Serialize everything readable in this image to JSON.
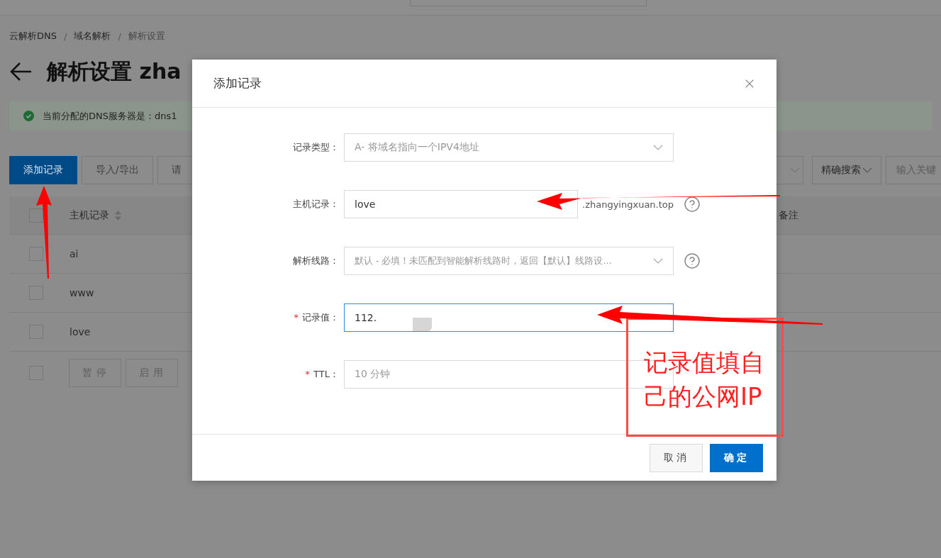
{
  "breadcrumb": [
    {
      "label": "云解析DNS"
    },
    {
      "separator": "/",
      "label": "域名解析"
    },
    {
      "separator": "/",
      "label": "解析设置"
    }
  ],
  "title": "解析设置 zha",
  "alert": {
    "text": "当前分配的DNS服务器是：dns1"
  },
  "toolbar": {
    "buttons": [
      {
        "label": "添加记录",
        "primary": true
      },
      {
        "label": "导入/导出",
        "primary": false
      },
      {
        "label": "请",
        "primary": false
      }
    ],
    "search_mode": "精确搜索",
    "search_placeholder": "输入关键"
  },
  "table": {
    "header_checked": false,
    "footer_checked": false,
    "columns": [
      {
        "label": "主机记录",
        "sortable": true
      },
      {
        "label": "备注",
        "sortable": false
      }
    ],
    "rows": [
      {
        "host": "ai",
        "checked": false
      },
      {
        "host": "www",
        "checked": false
      },
      {
        "host": "love",
        "checked": false
      }
    ],
    "footer_buttons": [
      "暂停",
      "启用"
    ]
  },
  "dialog": {
    "title": "添加记录",
    "fields": [
      {
        "label": "记录类型：",
        "kind": "select",
        "value": "A- 将域名指向一个IPV4地址",
        "chevron": true,
        "focused": false,
        "help": false
      },
      {
        "label": "主机记录：",
        "kind": "input",
        "value": "love",
        "suffix": ".zhangyingxuan.top",
        "focused": false,
        "help": true
      },
      {
        "label": "解析线路：",
        "kind": "select",
        "value": "默认 - 必填！未匹配到智能解析线路时，返回【默认】线路设...",
        "chevron": true,
        "focused": false,
        "help": true
      },
      {
        "marker": "*",
        "label": "记录值：",
        "kind": "input",
        "value": "112.",
        "focused": true,
        "help": false
      },
      {
        "marker": "*",
        "label": "TTL：",
        "kind": "select",
        "value": "10 分钟",
        "chevron": false,
        "focused": false,
        "help": false
      }
    ],
    "buttons": [
      {
        "label": "取消",
        "primary": false
      },
      {
        "label": "确定",
        "primary": true
      }
    ]
  },
  "annotation": {
    "text": "记录值填自己的公网IP"
  }
}
